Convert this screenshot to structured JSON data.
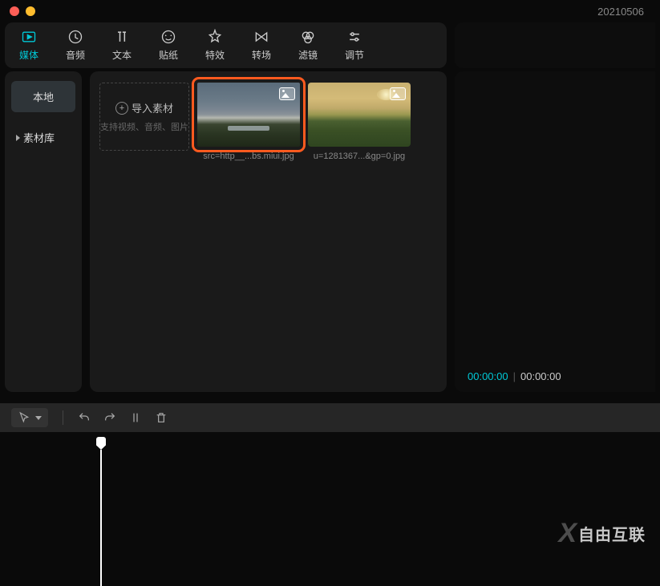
{
  "header": {
    "date": "20210506"
  },
  "tabs": {
    "media": "媒体",
    "audio": "音频",
    "text": "文本",
    "sticker": "贴纸",
    "effect": "特效",
    "transition": "转场",
    "filter": "滤镜",
    "adjust": "调节"
  },
  "sidebar": {
    "local": "本地",
    "library": "素材库"
  },
  "import": {
    "label": "导入素材",
    "sublabel": "支持视频、音频、图片"
  },
  "media": {
    "items": [
      {
        "name": "src=http__...bs.miui.jpg"
      },
      {
        "name": "u=1281367...&gp=0.jpg"
      }
    ]
  },
  "preview": {
    "current_time": "00:00:00",
    "total_time": "00:00:00"
  },
  "watermark": {
    "text": "自由互联"
  }
}
